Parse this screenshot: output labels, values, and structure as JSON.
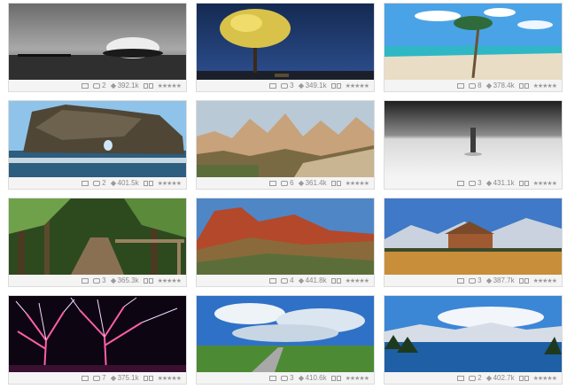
{
  "colors": {
    "card_bg": "#f4f4f4",
    "border": "#dcdcdc",
    "meta_text": "#8a8a8a"
  },
  "icons": {
    "picture": "picture-icon",
    "comment": "comment-icon",
    "views": "views-icon",
    "slideshow": "slideshow-icon",
    "rating": "rating-stars-icon"
  },
  "gallery": [
    {
      "scene": "dark-lake-rock",
      "comments": "2",
      "views": "392.1k",
      "stars": "★★★★★"
    },
    {
      "scene": "tree-night",
      "comments": "3",
      "views": "349.1k",
      "stars": "★★★★★"
    },
    {
      "scene": "palm-beach",
      "comments": "8",
      "views": "378.4k",
      "stars": "★★★★★"
    },
    {
      "scene": "sea-rock-arch",
      "comments": "2",
      "views": "401.5k",
      "stars": "★★★★★"
    },
    {
      "scene": "fairy-chimneys",
      "comments": "6",
      "views": "361.4k",
      "stars": "★★★★★"
    },
    {
      "scene": "bw-snow-figure",
      "comments": "3",
      "views": "431.1k",
      "stars": "★★★★★"
    },
    {
      "scene": "forest-boardwalk",
      "comments": "3",
      "views": "365.3k",
      "stars": "★★★★★"
    },
    {
      "scene": "red-mountain",
      "comments": "4",
      "views": "441.8k",
      "stars": "★★★★★"
    },
    {
      "scene": "barn-mountains",
      "comments": "3",
      "views": "387.7k",
      "stars": "★★★★★"
    },
    {
      "scene": "neon-trees",
      "comments": "7",
      "views": "375.1k",
      "stars": "★★★★★"
    },
    {
      "scene": "road-meadow-sky",
      "comments": "3",
      "views": "410.6k",
      "stars": "★★★★★"
    },
    {
      "scene": "mountain-lake",
      "comments": "2",
      "views": "402.7k",
      "stars": "★★★★★"
    }
  ]
}
